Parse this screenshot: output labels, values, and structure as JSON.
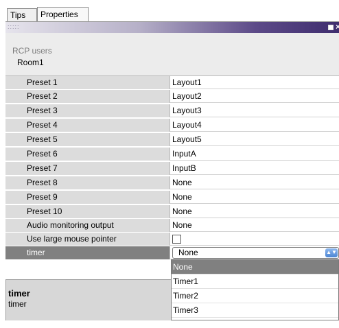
{
  "tabs": [
    {
      "label": "Tips"
    },
    {
      "label": "Properties"
    }
  ],
  "titlebar": {
    "grip": ":::::",
    "close": "×"
  },
  "header": {
    "label": "RCP users",
    "value": "Room1"
  },
  "properties": [
    {
      "name": "Preset 1",
      "value": "Layout1"
    },
    {
      "name": "Preset 2",
      "value": "Layout2"
    },
    {
      "name": "Preset 3",
      "value": "Layout3"
    },
    {
      "name": "Preset 4",
      "value": "Layout4"
    },
    {
      "name": "Preset 5",
      "value": "Layout5"
    },
    {
      "name": "Preset 6",
      "value": "InputA"
    },
    {
      "name": "Preset 7",
      "value": "InputB"
    },
    {
      "name": "Preset 8",
      "value": "None"
    },
    {
      "name": "Preset 9",
      "value": "None"
    },
    {
      "name": "Preset 10",
      "value": "None"
    },
    {
      "name": "Audio monitoring output",
      "value": "None"
    },
    {
      "name": "Use large mouse pointer",
      "value": ""
    },
    {
      "name": "timer",
      "value": "None"
    }
  ],
  "dropdown": {
    "options": [
      "None",
      "Timer1",
      "Timer2",
      "Timer3"
    ],
    "selected": "None"
  },
  "description": {
    "title": "timer",
    "text": "timer"
  }
}
